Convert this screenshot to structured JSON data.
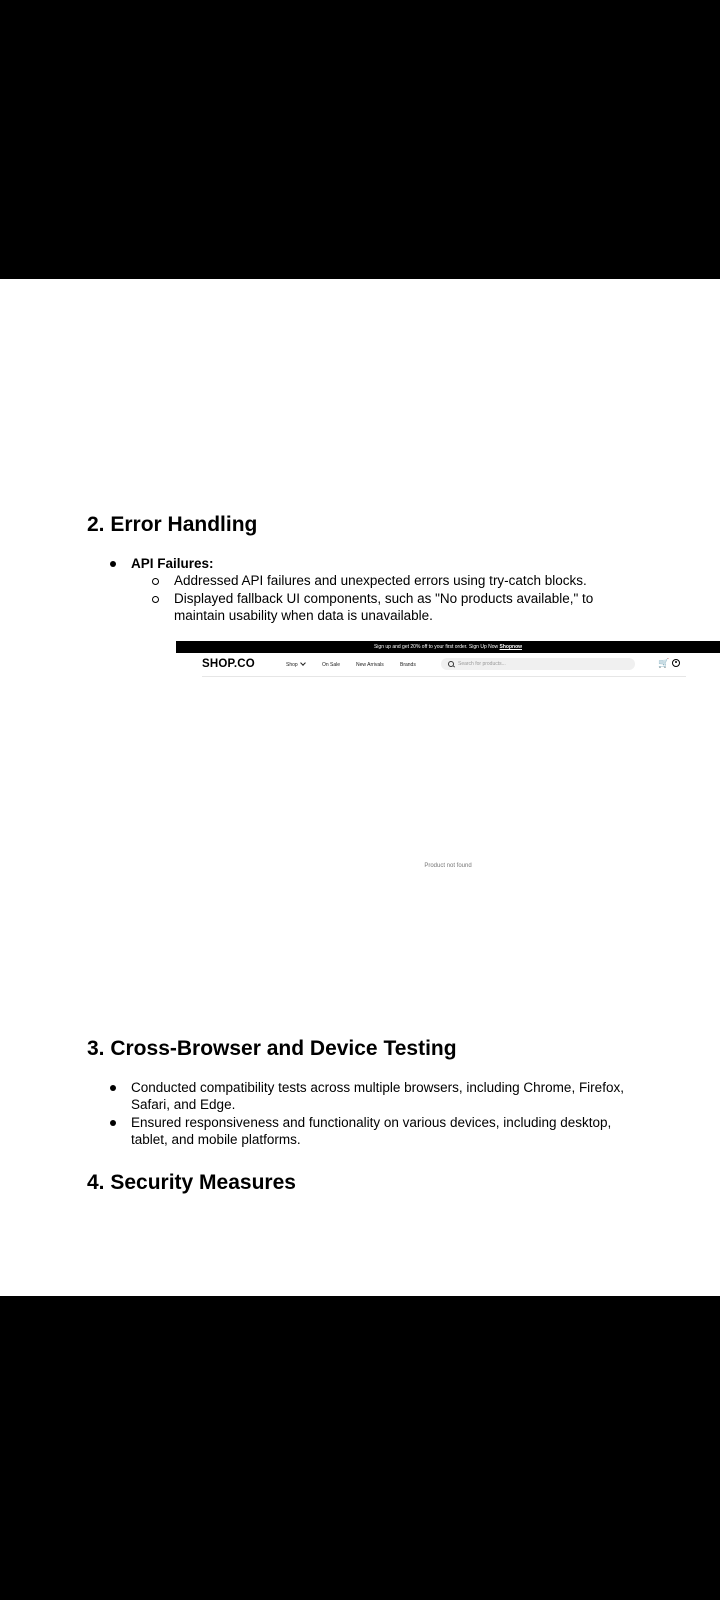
{
  "sections": {
    "error_handling": {
      "heading": "2. Error Handling",
      "api_failures_label": "API Failures:",
      "sub_items": [
        "Addressed API failures and unexpected errors using try-catch blocks.",
        "Displayed fallback UI components, such as \"No products available,\" to",
        "maintain usability when data is unavailable."
      ]
    },
    "cross_browser": {
      "heading": "3. Cross-Browser and Device Testing",
      "items": [
        "Conducted compatibility tests across multiple browsers, including Chrome, Firefox,",
        "Safari, and Edge.",
        "Ensured responsiveness and functionality on various devices, including desktop,",
        "tablet, and mobile platforms."
      ]
    },
    "security": {
      "heading": "4. Security Measures"
    }
  },
  "screenshot": {
    "promo_text": "Sign up and get 20% off to your first order. Sign Up Now",
    "promo_link": "Shopnow",
    "logo": "SHOP.CO",
    "nav": [
      "Shop",
      "On Sale",
      "New Arrivals",
      "Brands"
    ],
    "search_placeholder": "Search for products...",
    "empty_message": "Product not found"
  },
  "icons": [
    "search-icon",
    "cart-icon",
    "user-icon",
    "chevron-down-icon"
  ]
}
